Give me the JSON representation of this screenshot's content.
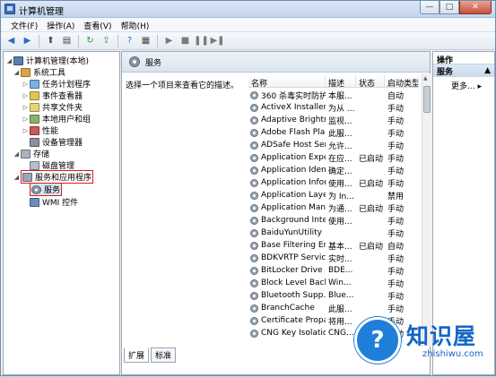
{
  "window": {
    "title": "计算机管理"
  },
  "window_buttons": {
    "minimize": "—",
    "maximize": "□",
    "close": "✕"
  },
  "menubar": [
    "文件(F)",
    "操作(A)",
    "查看(V)",
    "帮助(H)"
  ],
  "tree": [
    {
      "label": "计算机管理(本地)",
      "icon": "computer-icon",
      "level": 0,
      "arrow": "◢"
    },
    {
      "label": "系统工具",
      "icon": "tools-icon",
      "level": 1,
      "arrow": "◢"
    },
    {
      "label": "任务计划程序",
      "icon": "task-scheduler-icon",
      "level": 2,
      "arrow": "▷"
    },
    {
      "label": "事件查看器",
      "icon": "event-viewer-icon",
      "level": 2,
      "arrow": "▷"
    },
    {
      "label": "共享文件夹",
      "icon": "shared-folder-icon",
      "level": 2,
      "arrow": "▷"
    },
    {
      "label": "本地用户和组",
      "icon": "users-icon",
      "level": 2,
      "arrow": "▷"
    },
    {
      "label": "性能",
      "icon": "performance-icon",
      "level": 2,
      "arrow": "▷"
    },
    {
      "label": "设备管理器",
      "icon": "device-manager-icon",
      "level": 2,
      "arrow": ""
    },
    {
      "label": "存储",
      "icon": "storage-icon",
      "level": 1,
      "arrow": "◢"
    },
    {
      "label": "磁盘管理",
      "icon": "disk-icon",
      "level": 2,
      "arrow": ""
    },
    {
      "label": "服务和应用程序",
      "icon": "services-apps-icon",
      "level": 1,
      "arrow": "◢"
    },
    {
      "label": "服务",
      "icon": "services-gear-icon",
      "level": 2,
      "arrow": ""
    },
    {
      "label": "WMI 控件",
      "icon": "wmi-icon",
      "level": 2,
      "arrow": ""
    }
  ],
  "center": {
    "header": "服务",
    "description": "选择一个项目来查看它的描述。",
    "columns": [
      "名称",
      "描述",
      "状态",
      "启动类型"
    ],
    "rows": [
      [
        "360 杀毒实时防护...",
        "本服...",
        "",
        "自动"
      ],
      [
        "ActiveX Installer ...",
        "为从 ...",
        "",
        "手动"
      ],
      [
        "Adaptive Brightn...",
        "监视...",
        "",
        "手动"
      ],
      [
        "Adobe Flash Pla...",
        "此服...",
        "",
        "手动"
      ],
      [
        "ADSafe Host Ser...",
        "允许...",
        "",
        "手动"
      ],
      [
        "Application Expe...",
        "在应...",
        "已启动",
        "手动"
      ],
      [
        "Application Iden...",
        "确定...",
        "",
        "手动"
      ],
      [
        "Application Infor...",
        "使用...",
        "已启动",
        "手动"
      ],
      [
        "Application Laye...",
        "为 In...",
        "",
        "禁用"
      ],
      [
        "Application Man...",
        "为通...",
        "已启动",
        "手动"
      ],
      [
        "Background Inte...",
        "使用...",
        "",
        "手动"
      ],
      [
        "BaiduYunUtility",
        "",
        "",
        "手动"
      ],
      [
        "Base Filtering En...",
        "基本...",
        "已启动",
        "自动"
      ],
      [
        "BDKVRTP Service",
        "实时...",
        "",
        "手动"
      ],
      [
        "BitLocker Drive ...",
        "BDE...",
        "",
        "手动"
      ],
      [
        "Block Level Back...",
        "Win...",
        "",
        "手动"
      ],
      [
        "Bluetooth Supp...",
        "Blue...",
        "",
        "手动"
      ],
      [
        "BranchCache",
        "此服...",
        "",
        "手动"
      ],
      [
        "Certificate Propa...",
        "将用...",
        "",
        "手动"
      ],
      [
        "CNG Key Isolation",
        "CNG...",
        "",
        "手动"
      ]
    ],
    "tabs": [
      "扩展",
      "标准"
    ]
  },
  "actions": {
    "title": "操作",
    "section": "服务",
    "more": "更多..."
  },
  "watermark": {
    "name": "知识屋",
    "url": "zhishiwu.com",
    "symbol": "?"
  }
}
